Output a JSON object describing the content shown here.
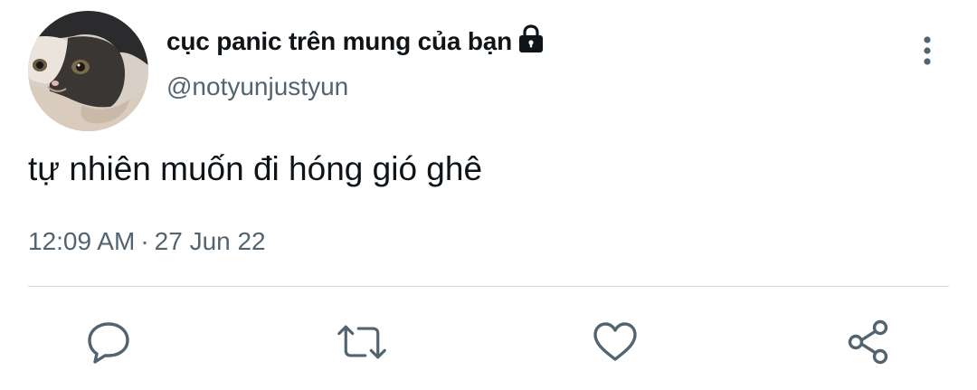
{
  "tweet": {
    "author": {
      "display_name": "cục panic trên mung của bạn",
      "handle": "@notyunjustyun",
      "protected_icon": "lock-icon"
    },
    "text": "tự nhiên muốn đi hóng gió ghê",
    "time": "12:09 AM",
    "separator": "·",
    "date": "27 Jun 22"
  },
  "actions": {
    "reply_icon": "speech-bubble-icon",
    "retweet_icon": "retweet-arrows-icon",
    "like_icon": "heart-icon",
    "share_icon": "share-nodes-icon"
  },
  "colors": {
    "text_primary": "#0f1419",
    "text_secondary": "#536471",
    "divider": "#cfd9de"
  }
}
